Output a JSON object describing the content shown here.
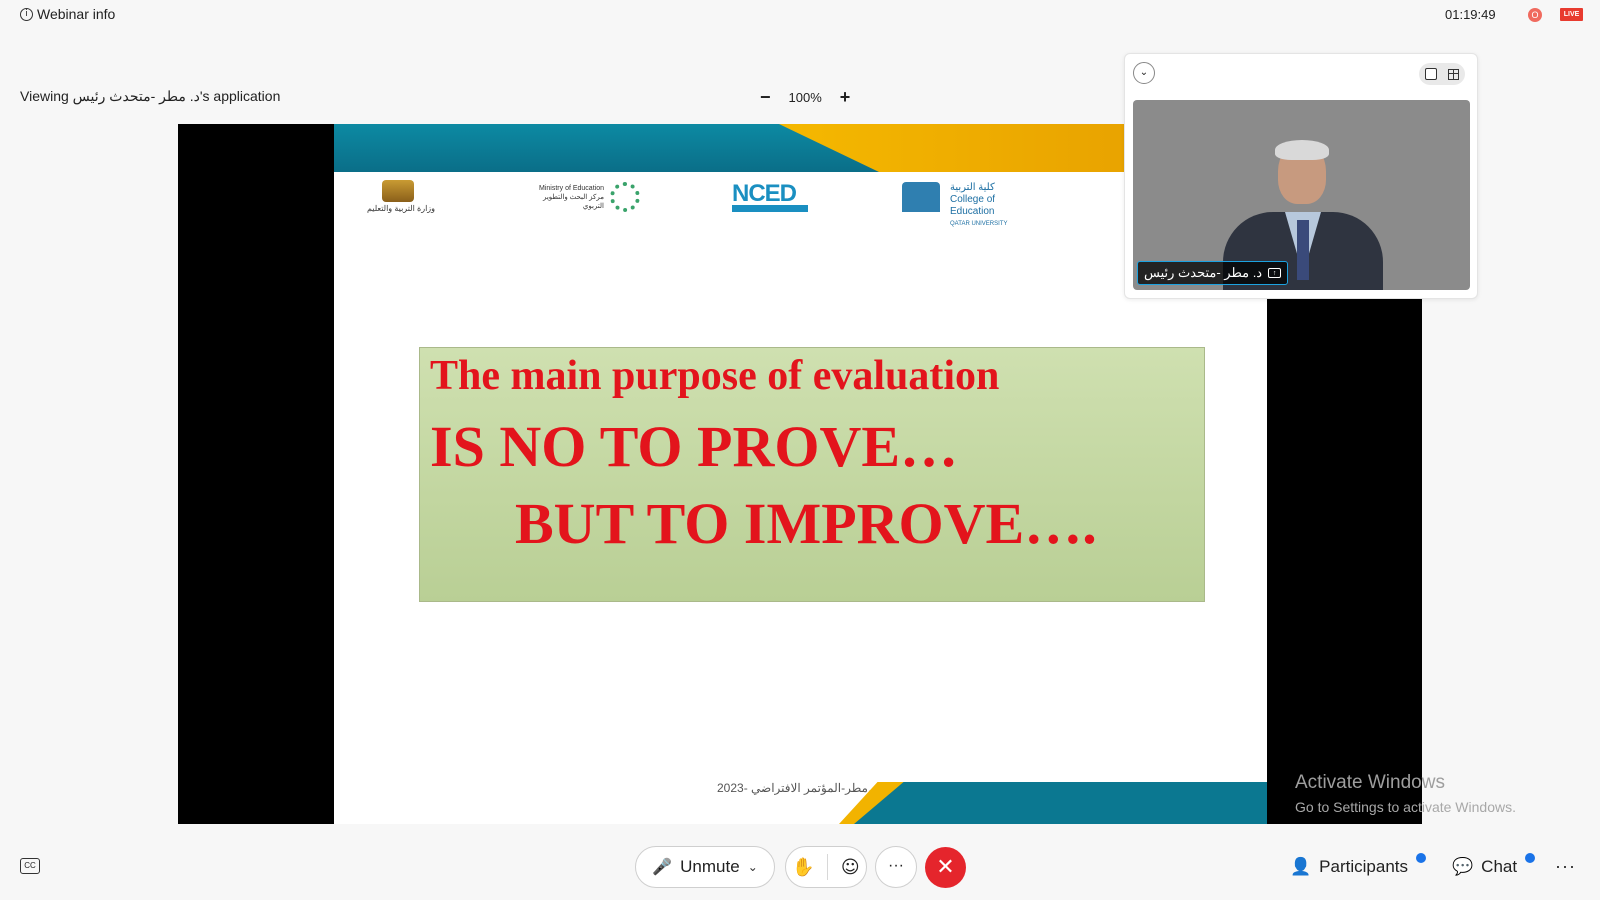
{
  "topbar": {
    "webinar_info": "Webinar info",
    "info_glyph": "i",
    "elapsed_time": "01:19:49",
    "recording_glyph": "O",
    "live_badge": "LIVE"
  },
  "share": {
    "viewing_label": "Viewing د. مطر -متحدث رئيس's application",
    "zoom_out": "−",
    "zoom_level": "100%",
    "zoom_in": "+"
  },
  "slide": {
    "logos": {
      "ministry": "وزارة التربية والتعليم",
      "research_center": "Ministry of Education مركز البحث والتطوير التربوي",
      "nced": "NCED",
      "college_ar": "كلية التربية",
      "college_en": "College of Education",
      "college_sub": "QATAR UNIVERSITY"
    },
    "line1": "The main purpose of evaluation",
    "line2": "IS NO TO PROVE…",
    "line3": "BUT TO IMPROVE….",
    "footer_text": "2023- د.مطر-المؤتمر الافتراضي"
  },
  "video": {
    "collapse_glyph": "⌄",
    "speaker_name": "د. مطر -متحدث رئيس",
    "screen_glyph": "↑"
  },
  "watermark": {
    "line1": "Activate Windows",
    "line2": "Go to Settings to activate Windows."
  },
  "bottombar": {
    "cc_label": "CC",
    "mic_glyph": "🎤",
    "unmute_label": "Unmute",
    "chevron_glyph": "⌄",
    "raise_hand_glyph": "✋",
    "reactions_glyph": "☺",
    "more_glyph": "···",
    "leave_glyph": "✕",
    "participants_glyph": "👤",
    "participants_label": "Participants",
    "chat_glyph": "💬",
    "chat_label": "Chat",
    "overflow_glyph": "···"
  },
  "colors": {
    "accent_red": "#e5252c",
    "slide_text_red": "#e3141c",
    "badge_blue": "#1a73e8",
    "name_tag_border": "#1ca2e0"
  }
}
